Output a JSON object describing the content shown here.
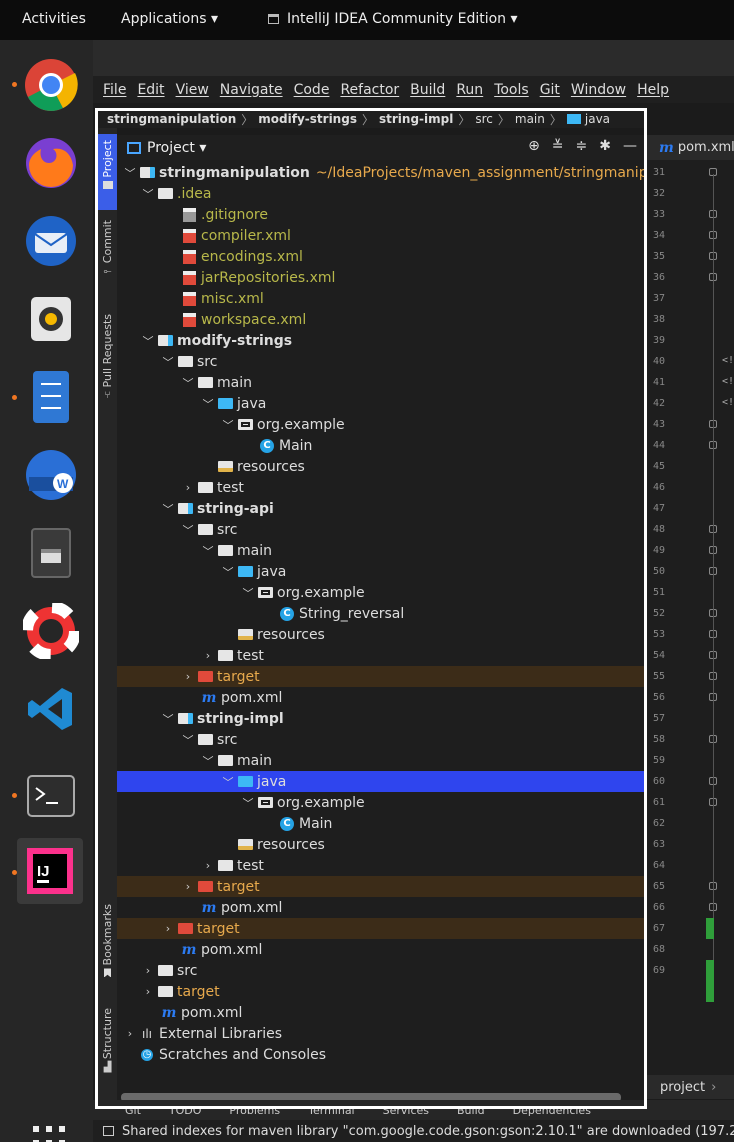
{
  "topbar": {
    "activities": "Activities",
    "applications": "Applications ▾",
    "app_title": "IntelliJ IDEA Community Edition ▾"
  },
  "menu": [
    "File",
    "Edit",
    "View",
    "Navigate",
    "Code",
    "Refactor",
    "Build",
    "Run",
    "Tools",
    "Git",
    "Window",
    "Help"
  ],
  "breadcrumb": [
    "stringmanipulation",
    "modify-strings",
    "string-impl",
    "src",
    "main",
    "java"
  ],
  "side_tabs": [
    "Project",
    "Commit",
    "Pull Requests",
    "Bookmarks",
    "Structure"
  ],
  "panel": {
    "title": "Project ▾"
  },
  "tree": [
    {
      "text": "stringmanipulation",
      "path": "~/IdeaProjects/maven_assignment/stringmanipula"
    },
    {
      "text": ".idea"
    },
    {
      "text": ".gitignore"
    },
    {
      "text": "compiler.xml"
    },
    {
      "text": "encodings.xml"
    },
    {
      "text": "jarRepositories.xml"
    },
    {
      "text": "misc.xml"
    },
    {
      "text": "workspace.xml"
    },
    {
      "text": "modify-strings"
    },
    {
      "text": "src"
    },
    {
      "text": "main"
    },
    {
      "text": "java"
    },
    {
      "text": "org.example"
    },
    {
      "text": "Main"
    },
    {
      "text": "resources"
    },
    {
      "text": "test"
    },
    {
      "text": "string-api"
    },
    {
      "text": "src"
    },
    {
      "text": "main"
    },
    {
      "text": "java"
    },
    {
      "text": "org.example"
    },
    {
      "text": "String_reversal"
    },
    {
      "text": "resources"
    },
    {
      "text": "test"
    },
    {
      "text": "target"
    },
    {
      "text": "pom.xml"
    },
    {
      "text": "string-impl"
    },
    {
      "text": "src"
    },
    {
      "text": "main"
    },
    {
      "text": "java"
    },
    {
      "text": "org.example"
    },
    {
      "text": "Main"
    },
    {
      "text": "resources"
    },
    {
      "text": "test"
    },
    {
      "text": "target"
    },
    {
      "text": "pom.xml"
    },
    {
      "text": "target"
    },
    {
      "text": "pom.xml"
    },
    {
      "text": "src"
    },
    {
      "text": "target"
    },
    {
      "text": "pom.xml"
    },
    {
      "text": "External Libraries"
    },
    {
      "text": "Scratches and Consoles"
    }
  ],
  "editor": {
    "tab": "pom.xml",
    "line_numbers": [
      "31",
      "32",
      "33",
      "34",
      "35",
      "36",
      "37",
      "38",
      "39",
      "40",
      "41",
      "42",
      "43",
      "44",
      "45",
      "46",
      "47",
      "48",
      "49",
      "50",
      "51",
      "52",
      "53",
      "54",
      "55",
      "56",
      "57",
      "58",
      "59",
      "60",
      "61",
      "62",
      "63",
      "64",
      "65",
      "66",
      "67",
      "68",
      "69"
    ],
    "code_fragment": "<!",
    "footer": "project"
  },
  "bottom_tabs": [
    "Git",
    "TODO",
    "Problems",
    "Terminal",
    "Services",
    "Build",
    "Dependencies"
  ],
  "status": "Shared indexes for maven library \"com.google.code.gson:gson:2.10.1\" are downloaded (197.2"
}
